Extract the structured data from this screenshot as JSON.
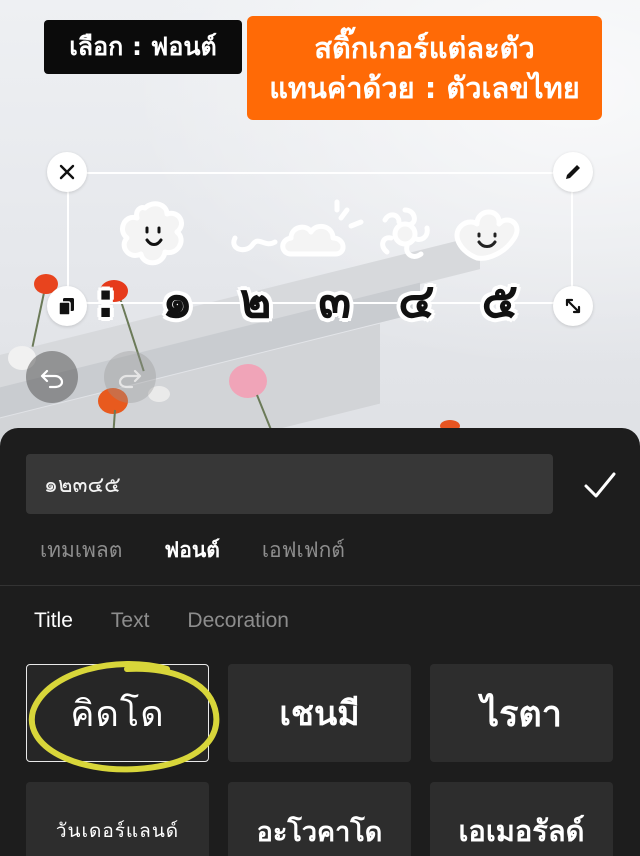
{
  "overlay": {
    "select_label": "เลือก : ฟอนต์",
    "instruction_line1": "สติ๊กเกอร์แต่ละตัว",
    "instruction_line2": "แทนค่าด้วย : ตัวเลขไทย"
  },
  "sticker": {
    "digits": [
      "๑",
      "๒",
      "๓",
      "๔",
      "๕"
    ],
    "doodles": [
      "flower-face",
      "swirl",
      "cloud",
      "flower",
      "heart-face"
    ]
  },
  "controls": {
    "close": "close-icon",
    "edit": "pencil-icon",
    "copy": "copy-icon",
    "resize": "resize-icon",
    "undo": "undo-icon",
    "redo": "redo-icon"
  },
  "editor": {
    "text_value": "๑๒๓๔๕",
    "confirm_icon": "checkmark-icon",
    "tabs": [
      {
        "label": "เทมเพลต",
        "active": false
      },
      {
        "label": "ฟอนต์",
        "active": true
      },
      {
        "label": "เอฟเฟกต์",
        "active": false
      }
    ],
    "subtabs": [
      {
        "label": "Title",
        "active": true
      },
      {
        "label": "Text",
        "active": false
      },
      {
        "label": "Decoration",
        "active": false
      }
    ],
    "fonts": [
      {
        "label": "คิดโด",
        "selected": true
      },
      {
        "label": "เชนมี",
        "selected": false
      },
      {
        "label": "ไรตา",
        "selected": false
      },
      {
        "label": "วันเดอร์แลนด์",
        "selected": false
      },
      {
        "label": "อะโวคาโด",
        "selected": false
      },
      {
        "label": "เอเมอรัลด์",
        "selected": false
      }
    ]
  },
  "colors": {
    "accent_orange": "#ff6a06",
    "highlight_yellow": "#d8d63a",
    "sheet_bg": "#1d1d1d",
    "card_bg": "#2d2d2d"
  }
}
